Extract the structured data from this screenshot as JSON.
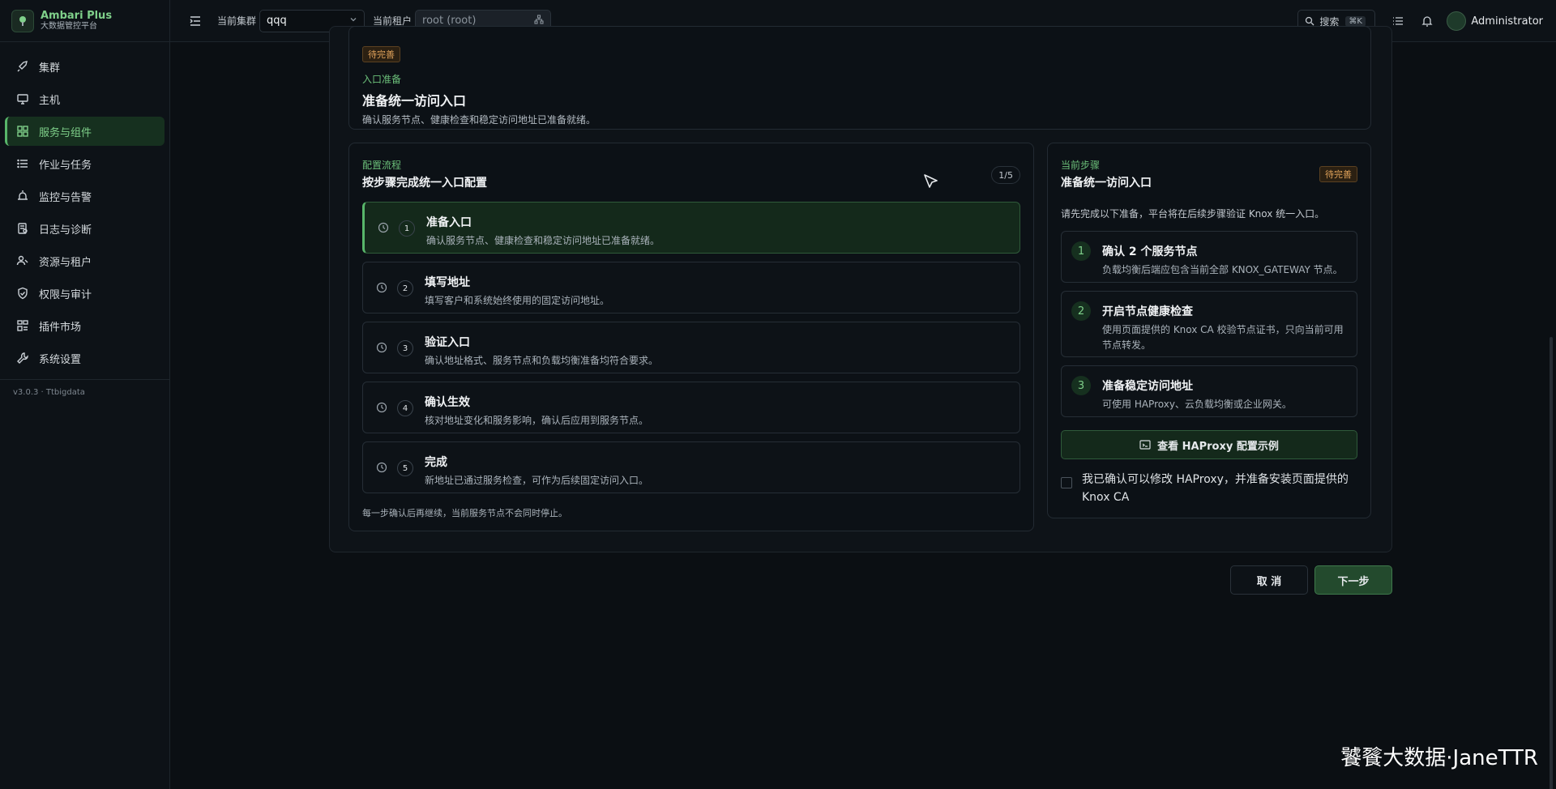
{
  "brand": {
    "name": "Ambari Plus",
    "subtitle": "大数据管控平台"
  },
  "sidebar": {
    "items": [
      {
        "label": "集群",
        "icon": "rocket-icon"
      },
      {
        "label": "主机",
        "icon": "monitor-icon"
      },
      {
        "label": "服务与组件",
        "icon": "grid-icon",
        "active": true
      },
      {
        "label": "作业与任务",
        "icon": "list-icon"
      },
      {
        "label": "监控与告警",
        "icon": "alarm-icon"
      },
      {
        "label": "日志与诊断",
        "icon": "log-icon"
      },
      {
        "label": "资源与租户",
        "icon": "users-icon"
      },
      {
        "label": "权限与审计",
        "icon": "shield-icon"
      },
      {
        "label": "插件市场",
        "icon": "plugin-icon"
      },
      {
        "label": "系统设置",
        "icon": "wrench-icon"
      }
    ],
    "version": "v3.0.3 · Ttbigdata"
  },
  "topbar": {
    "cluster_label": "当前集群",
    "cluster_value": "qqq",
    "tenant_label": "当前租户",
    "tenant_value": "root (root)",
    "search_label": "搜索",
    "search_kbd": "⌘K",
    "user_name": "Administrator"
  },
  "intro": {
    "badge": "待完善",
    "eyebrow": "入口准备",
    "title": "准备统一访问入口",
    "description": "确认服务节点、健康检查和稳定访问地址已准备就绪。"
  },
  "flow": {
    "eyebrow": "配置流程",
    "title": "按步骤完成统一入口配置",
    "counter": "1/5",
    "steps": [
      {
        "num": "1",
        "title": "准备入口",
        "desc": "确认服务节点、健康检查和稳定访问地址已准备就绪。",
        "active": true
      },
      {
        "num": "2",
        "title": "填写地址",
        "desc": "填写客户和系统始终使用的固定访问地址。"
      },
      {
        "num": "3",
        "title": "验证入口",
        "desc": "确认地址格式、服务节点和负载均衡准备均符合要求。"
      },
      {
        "num": "4",
        "title": "确认生效",
        "desc": "核对地址变化和服务影响，确认后应用到服务节点。"
      },
      {
        "num": "5",
        "title": "完成",
        "desc": "新地址已通过服务检查，可作为后续固定访问入口。"
      }
    ],
    "footer": "每一步确认后再继续，当前服务节点不会同时停止。"
  },
  "current": {
    "eyebrow": "当前步骤",
    "title": "准备统一访问入口",
    "badge": "待完善",
    "intro": "请先完成以下准备，平台将在后续步骤验证 Knox 统一入口。",
    "requirements": [
      {
        "num": "1",
        "title": "确认 2 个服务节点",
        "desc": "负载均衡后端应包含当前全部 KNOX_GATEWAY 节点。"
      },
      {
        "num": "2",
        "title": "开启节点健康检查",
        "desc": "使用页面提供的 Knox CA 校验节点证书，只向当前可用节点转发。"
      },
      {
        "num": "3",
        "title": "准备稳定访问地址",
        "desc": "可使用 HAProxy、云负载均衡或企业网关。"
      }
    ],
    "example_button": "查看 HAProxy 配置示例",
    "confirm_text": "我已确认可以修改 HAProxy，并准备安装页面提供的 Knox CA"
  },
  "actions": {
    "cancel": "取 消",
    "next": "下一步"
  },
  "watermark": "饕餮大数据·JaneTTR"
}
